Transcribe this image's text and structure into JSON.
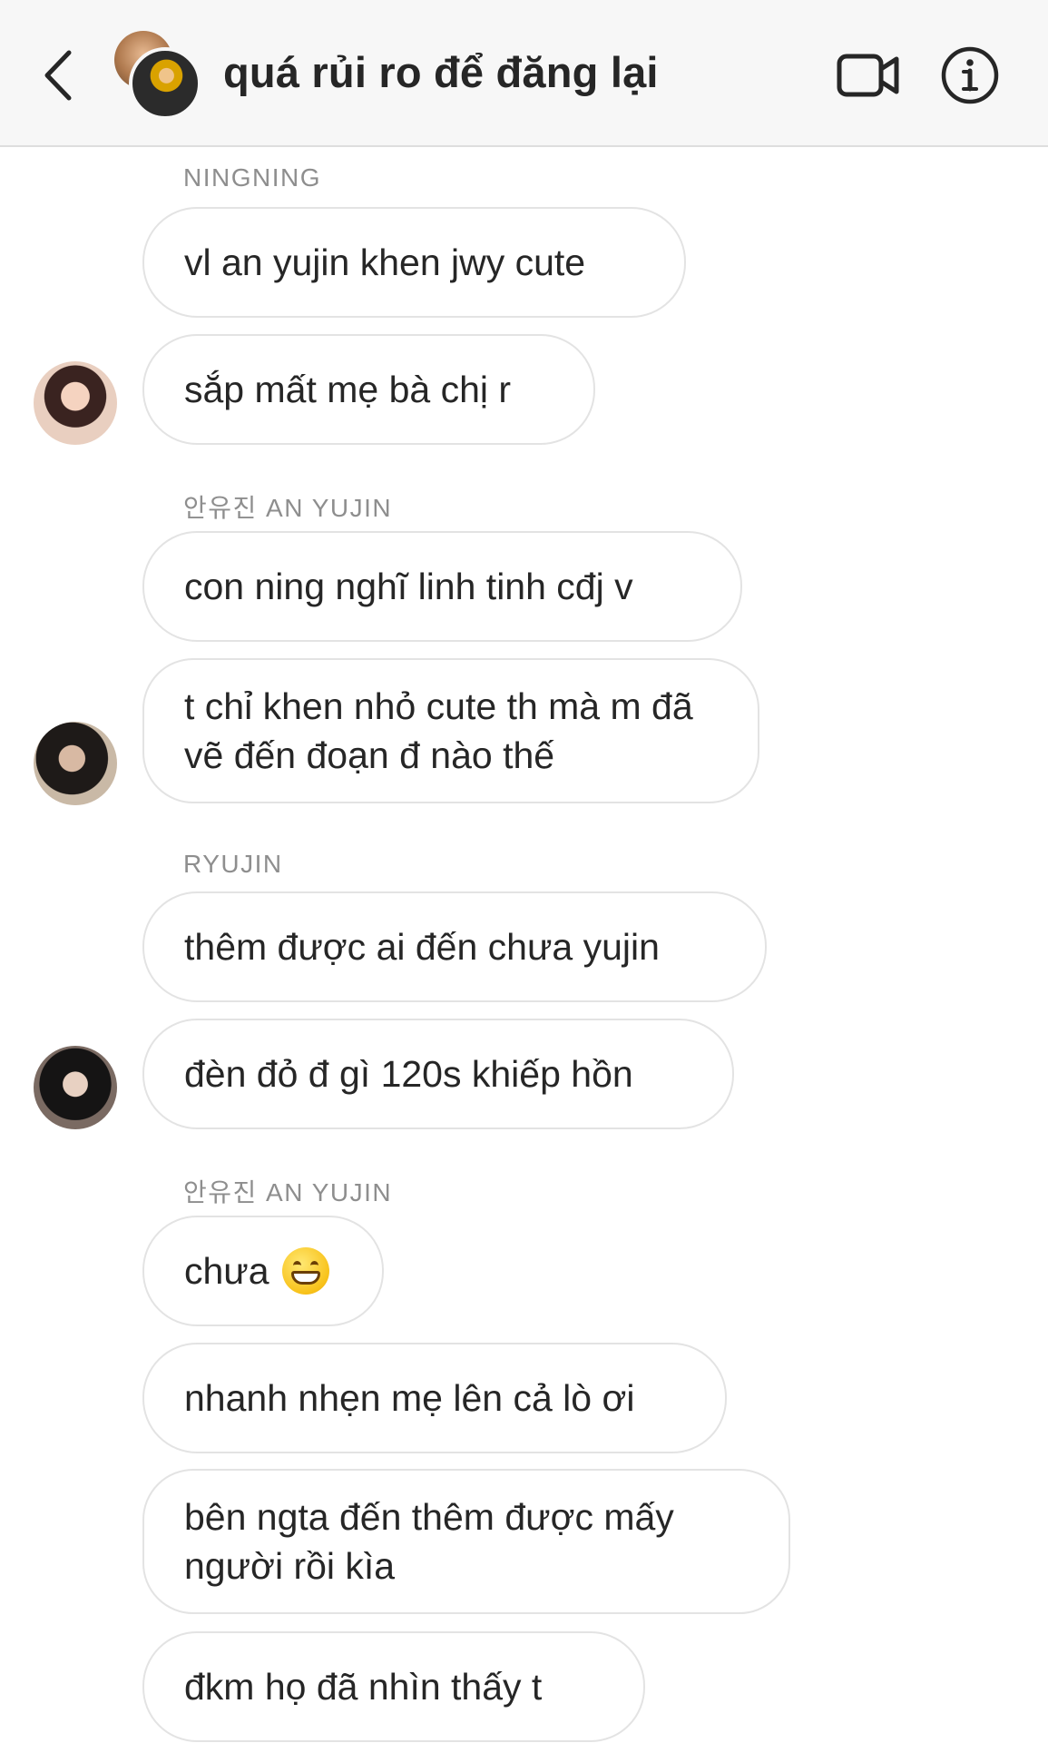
{
  "header": {
    "title": "quá rủi ro để đăng lại",
    "back_icon": "chevron-left-icon",
    "video_icon": "video-call-icon",
    "info_icon": "info-icon"
  },
  "messages": [
    {
      "sender": "NINGNING",
      "text": "vl an yujin khen jwy cute"
    },
    {
      "text": "sắp mất mẹ bà chị r"
    },
    {
      "sender": "안유진 AN YUJIN",
      "text": "con ning nghĩ linh tinh cđj v"
    },
    {
      "text": "t chỉ khen nhỏ cute th mà m đã vẽ đến đoạn đ nào thế"
    },
    {
      "sender": "RYUJIN",
      "text": "thêm được ai đến chưa yujin"
    },
    {
      "text": "đèn đỏ đ gì 120s khiếp hồn"
    },
    {
      "sender": "안유진 AN YUJIN",
      "text": "chưa",
      "emoji": "grinning-face-icon"
    },
    {
      "text": "nhanh nhẹn mẹ lên cả lò ơi"
    },
    {
      "text": "bên ngta đến thêm được mấy người rồi kìa"
    },
    {
      "text": "đkm họ đã nhìn thấy t"
    }
  ]
}
